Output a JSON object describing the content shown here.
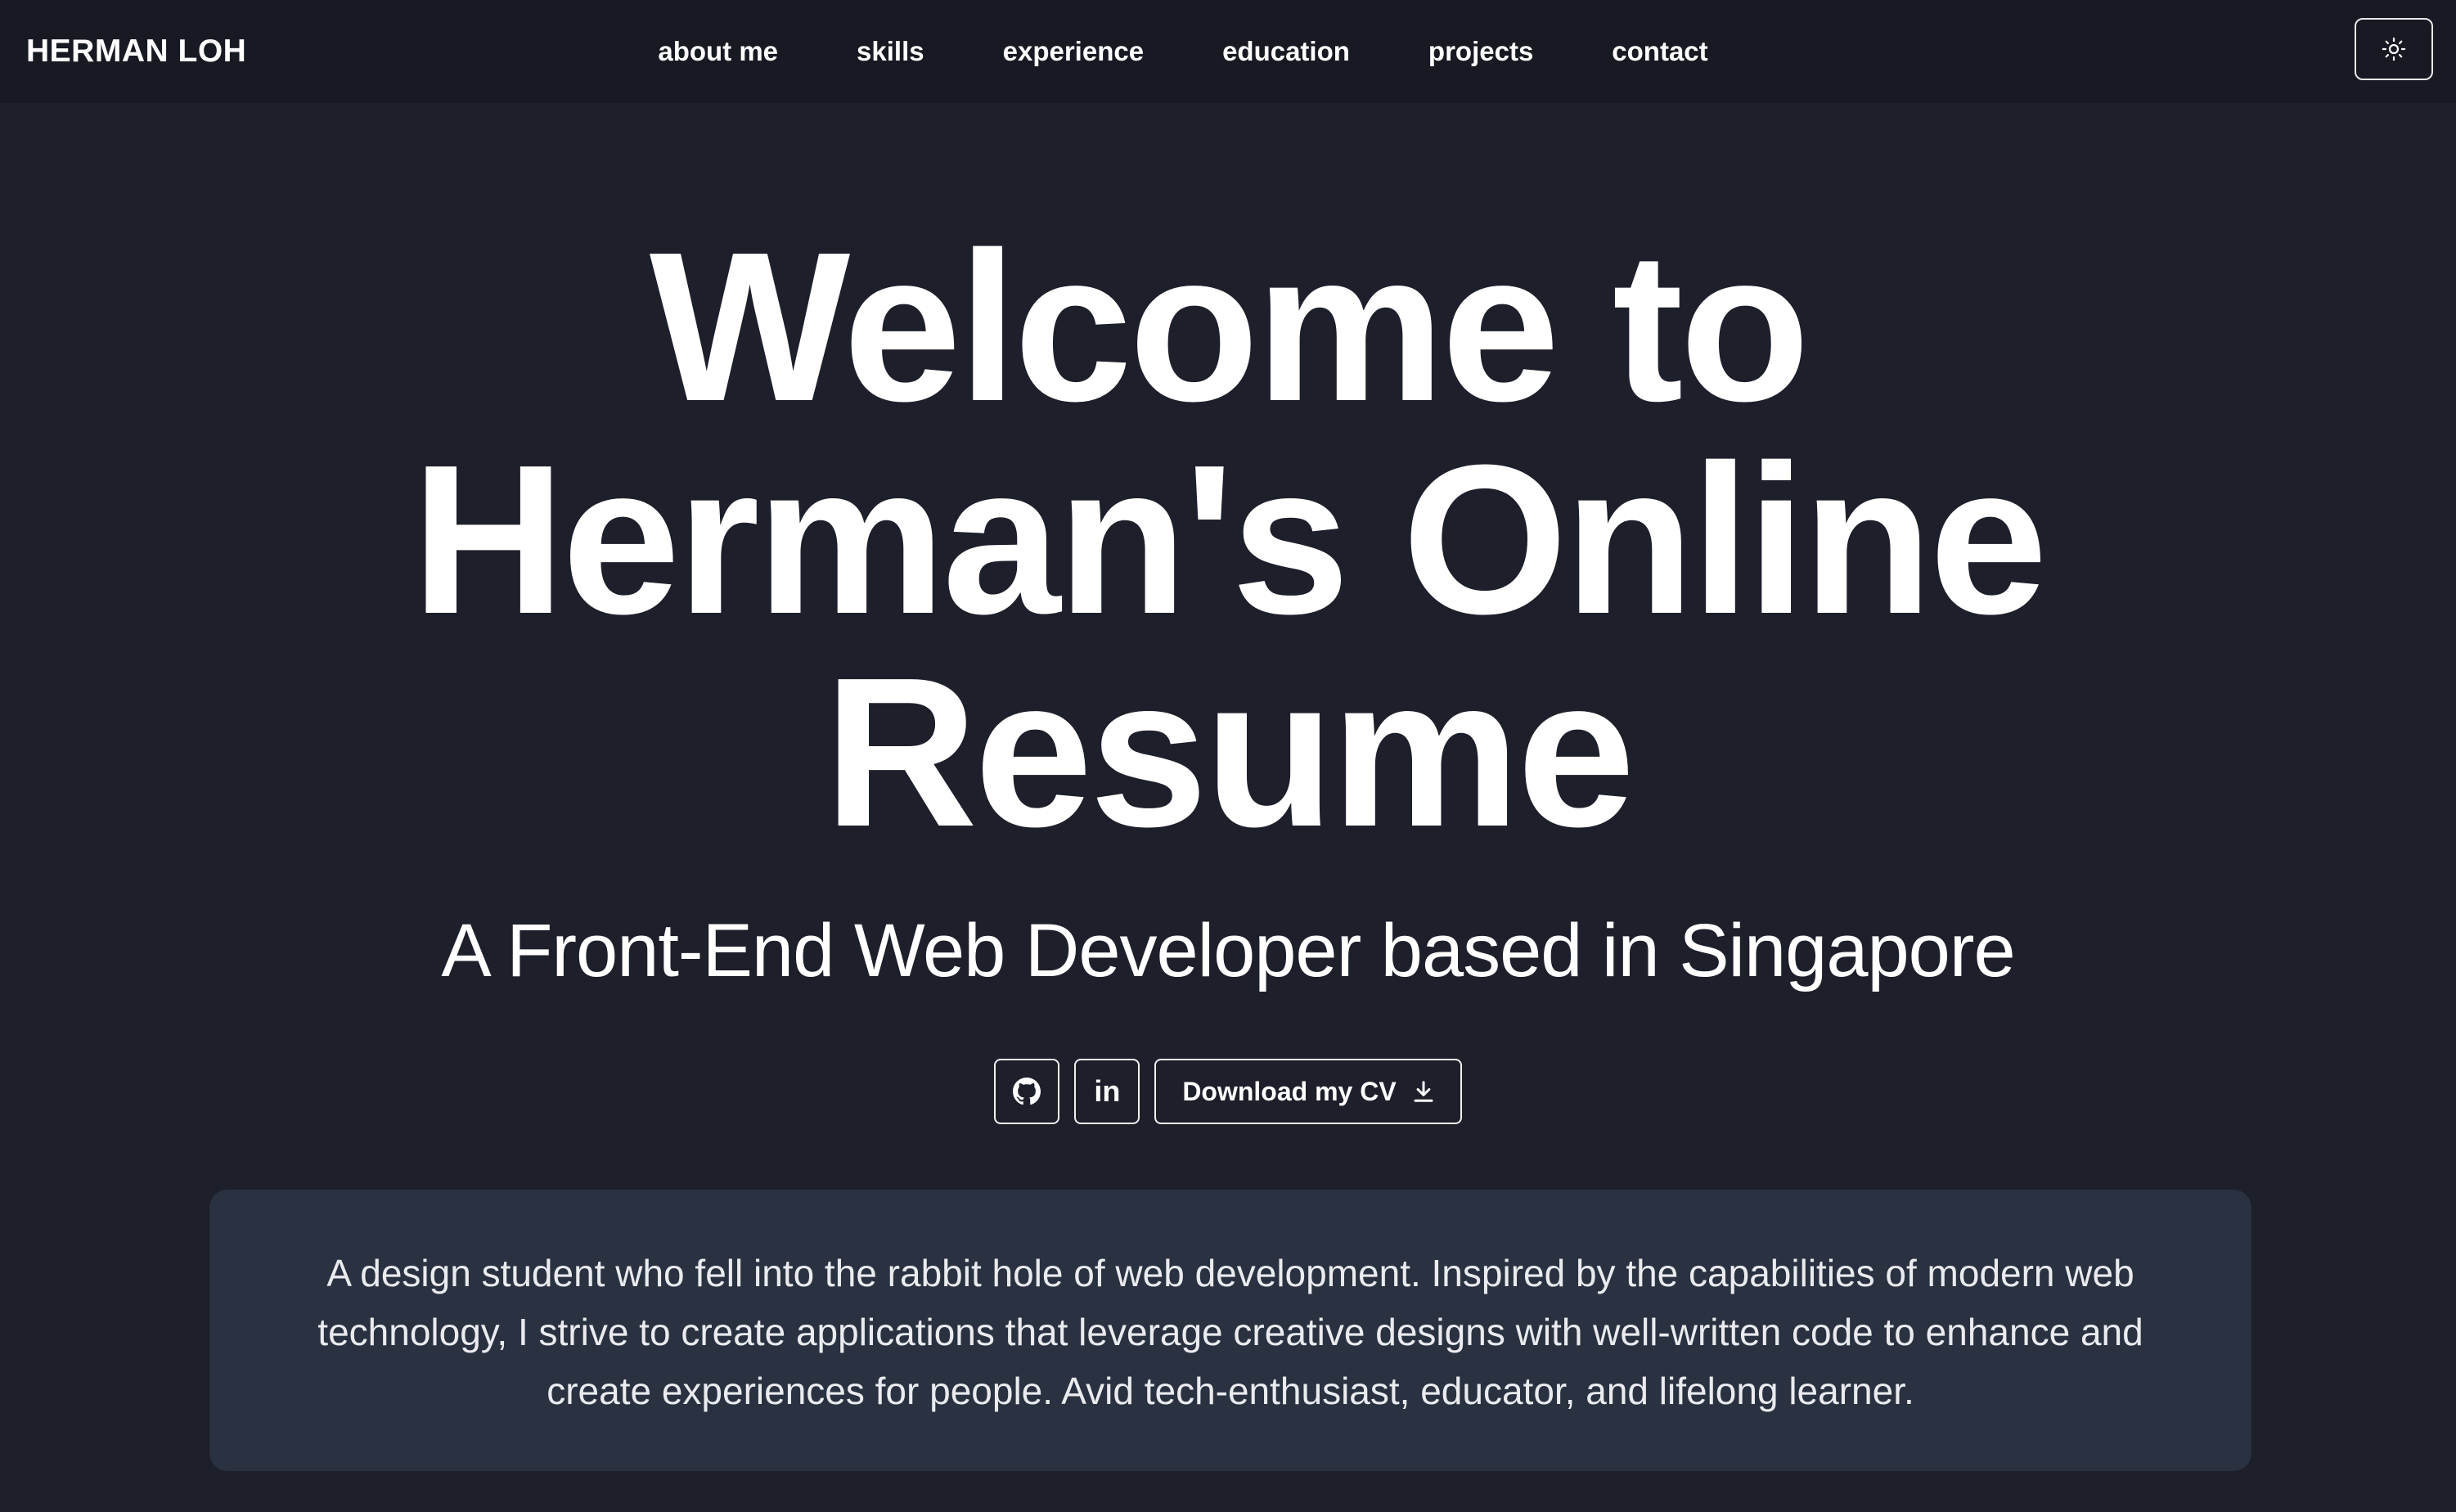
{
  "header": {
    "brand": "HERMAN LOH",
    "nav": [
      {
        "label": "about me"
      },
      {
        "label": "skills"
      },
      {
        "label": "experience"
      },
      {
        "label": "education"
      },
      {
        "label": "projects"
      },
      {
        "label": "contact"
      }
    ],
    "theme_toggle_icon": "sun-icon"
  },
  "hero": {
    "title": "Welcome to Herman's Online Resume",
    "subtitle": "A Front-End Web Developer based in Singapore"
  },
  "actions": {
    "github_icon": "github-icon",
    "linkedin_icon": "linkedin-icon",
    "linkedin_glyph": "in",
    "cv_label": "Download my CV",
    "cv_icon": "download-icon"
  },
  "about": {
    "text": "A design student who fell into the rabbit hole of web development. Inspired by the capabilities of modern web technology, I strive to create applications that leverage creative designs with well-written code to enhance and create experiences for people. Avid tech-enthusiast, educator, and lifelong learner."
  },
  "colors": {
    "background": "#1d1f2a",
    "navbar": "#181a23",
    "card": "#2a3140",
    "text": "#ffffff"
  }
}
